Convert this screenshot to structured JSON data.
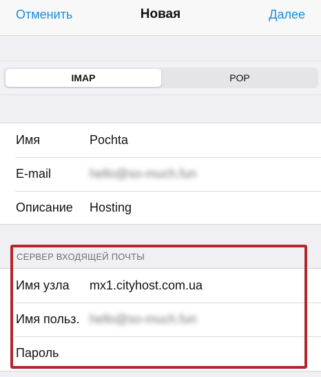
{
  "navbar": {
    "cancel_label": "Отменить",
    "title": "Новая",
    "next_label": "Далее"
  },
  "segmented": {
    "options": [
      "IMAP",
      "POP"
    ],
    "selected": "IMAP"
  },
  "account": {
    "name_label": "Имя",
    "name_value": "Pochta",
    "email_label": "E-mail",
    "email_value": "hello@so-much.fun",
    "description_label": "Описание",
    "description_value": "Hosting"
  },
  "incoming": {
    "header": "СЕРВЕР ВХОДЯЩЕЙ ПОЧТЫ",
    "host_label": "Имя узла",
    "host_value": "mx1.cityhost.com.ua",
    "user_label": "Имя польз.",
    "user_value": "hello@so-much.fun",
    "password_label": "Пароль",
    "password_value": ""
  },
  "colors": {
    "accent": "#1a8cd8",
    "highlight": "#b0282b",
    "background": "#efeff4"
  }
}
